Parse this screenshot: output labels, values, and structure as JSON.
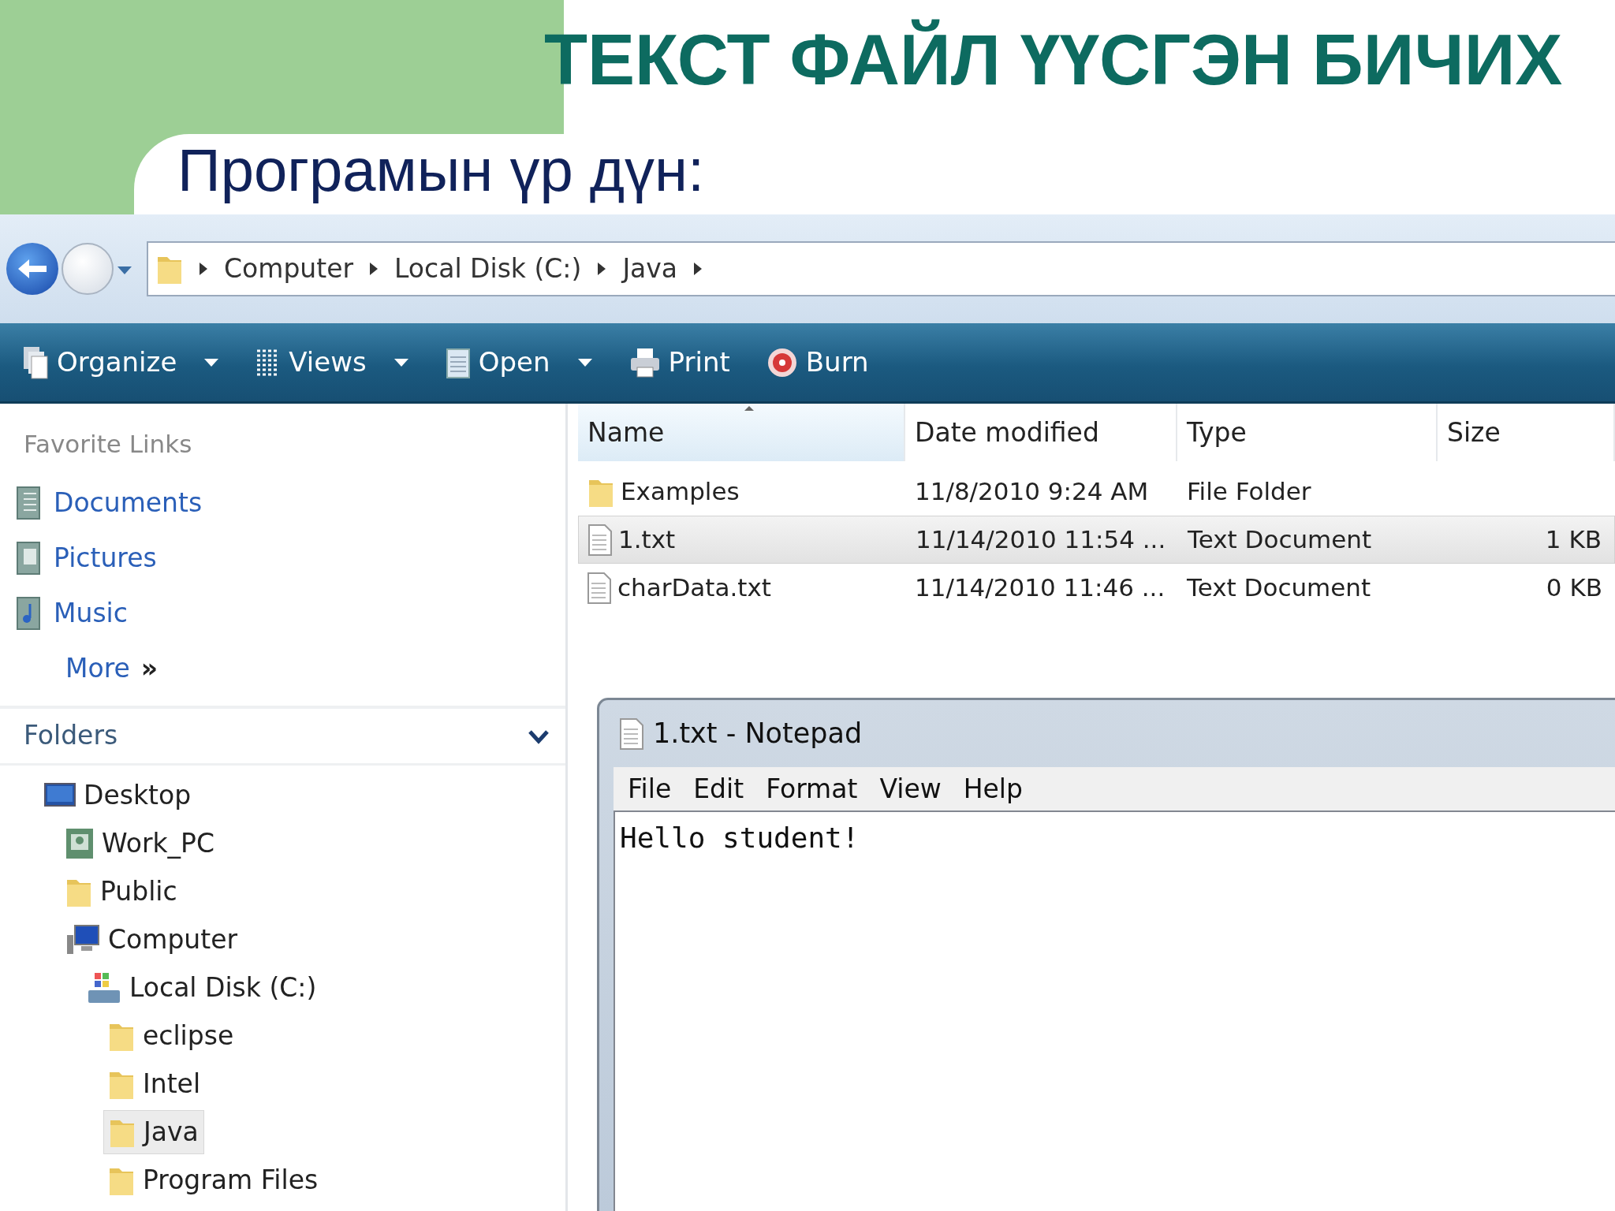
{
  "slide": {
    "title": "ТЕКСТ ФАЙЛ ҮҮСГЭН БИЧИХ",
    "subtitle": "Програмын үр дүн:"
  },
  "explorer": {
    "breadcrumb": [
      "Computer",
      "Local Disk (C:)",
      "Java"
    ],
    "toolbar": [
      {
        "label": "Organize",
        "kind": "organize",
        "dropdown": true
      },
      {
        "label": "Views",
        "kind": "views",
        "dropdown": true
      },
      {
        "label": "Open",
        "kind": "open",
        "dropdown": true
      },
      {
        "label": "Print",
        "kind": "print",
        "dropdown": false
      },
      {
        "label": "Burn",
        "kind": "burn",
        "dropdown": false
      }
    ],
    "favorite_links": {
      "heading": "Favorite Links",
      "items": [
        {
          "label": "Documents",
          "kind": "documents"
        },
        {
          "label": "Pictures",
          "kind": "pictures"
        },
        {
          "label": "Music",
          "kind": "music"
        }
      ],
      "more": "More",
      "more_mark": "»"
    },
    "folders": {
      "heading": "Folders",
      "expanded": true,
      "tree": [
        {
          "label": "Desktop",
          "kind": "desktop",
          "selected": false,
          "children": [
            {
              "label": "Work_PC",
              "kind": "user",
              "selected": false
            },
            {
              "label": "Public",
              "kind": "folder",
              "selected": false
            },
            {
              "label": "Computer",
              "kind": "computer",
              "selected": false,
              "children": [
                {
                  "label": "Local Disk (C:)",
                  "kind": "drive",
                  "selected": false,
                  "children": [
                    {
                      "label": "eclipse",
                      "kind": "folder",
                      "selected": false
                    },
                    {
                      "label": "Intel",
                      "kind": "folder",
                      "selected": false
                    },
                    {
                      "label": "Java",
                      "kind": "folder",
                      "selected": true
                    },
                    {
                      "label": "Program Files",
                      "kind": "folder",
                      "selected": false
                    }
                  ]
                }
              ]
            }
          ]
        }
      ]
    },
    "columns": [
      {
        "label": "Name",
        "sorted": true
      },
      {
        "label": "Date modified",
        "sorted": false
      },
      {
        "label": "Type",
        "sorted": false
      },
      {
        "label": "Size",
        "sorted": false
      }
    ],
    "files": [
      {
        "name": "Examples",
        "date": "11/8/2010 9:24 AM",
        "type": "File Folder",
        "kind": "folder",
        "selected": false
      },
      {
        "name": "1.txt",
        "date": "11/14/2010 11:54 ...",
        "type": "Text Document",
        "size": "1 KB",
        "kind": "text",
        "selected": true
      },
      {
        "name": "charData.txt",
        "date": "11/14/2010 11:46 ...",
        "type": "Text Document",
        "size": "0 KB",
        "kind": "text",
        "selected": false
      }
    ]
  },
  "notepad": {
    "title": "1.txt - Notepad",
    "menu": [
      "File",
      "Edit",
      "Format",
      "View",
      "Help"
    ],
    "content": "Hello student!"
  }
}
